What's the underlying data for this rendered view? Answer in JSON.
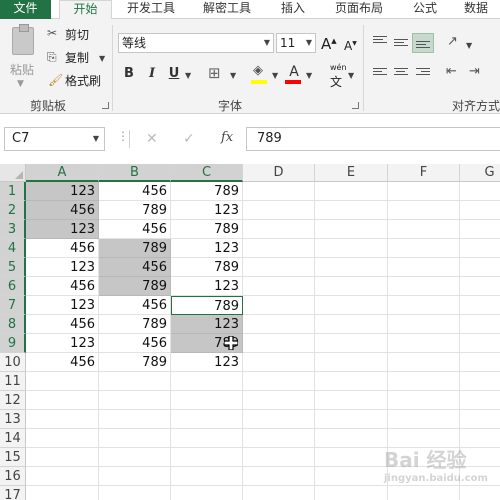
{
  "tabs": {
    "file": "文件",
    "home": "开始",
    "dev": "开发工具",
    "decrypt": "解密工具",
    "insert": "插入",
    "layout": "页面布局",
    "formula": "公式",
    "data": "数据"
  },
  "ribbon": {
    "paste": "粘贴",
    "cut": "剪切",
    "copy": "复制",
    "format_painter": "格式刷",
    "clipboard_group": "剪贴板",
    "font_name": "等线",
    "font_size": "11",
    "font_group": "字体",
    "align_group": "对齐方式",
    "bold": "B",
    "italic": "I",
    "underline": "U",
    "grow": "A",
    "shrink": "A",
    "font_color_letter": "A",
    "wen": "wén",
    "wen_char": "文"
  },
  "colors": {
    "accent": "#217346",
    "highlight_yellow": "#ffff00",
    "font_red": "#ff0000",
    "selection_gray": "#c6c6c6"
  },
  "formula_bar": {
    "name_box": "C7",
    "fx": "fx",
    "value": "789",
    "dots": "⋮",
    "cancel": "✕",
    "enter": "✓"
  },
  "columns": [
    "A",
    "B",
    "C",
    "D",
    "E",
    "F",
    "G"
  ],
  "rows": [
    "1",
    "2",
    "3",
    "4",
    "5",
    "6",
    "7",
    "8",
    "9",
    "10",
    "11",
    "12",
    "13",
    "14",
    "15",
    "16",
    "17"
  ],
  "cells": [
    [
      "123",
      "456",
      "789"
    ],
    [
      "456",
      "789",
      "123"
    ],
    [
      "123",
      "456",
      "789"
    ],
    [
      "456",
      "789",
      "123"
    ],
    [
      "123",
      "456",
      "789"
    ],
    [
      "456",
      "789",
      "123"
    ],
    [
      "123",
      "456",
      "789"
    ],
    [
      "456",
      "789",
      "123"
    ],
    [
      "123",
      "456",
      "789"
    ],
    [
      "456",
      "789",
      "123"
    ]
  ],
  "watermark": {
    "brand": "Bai 经验",
    "domain": "jingyan.baidu.com"
  }
}
